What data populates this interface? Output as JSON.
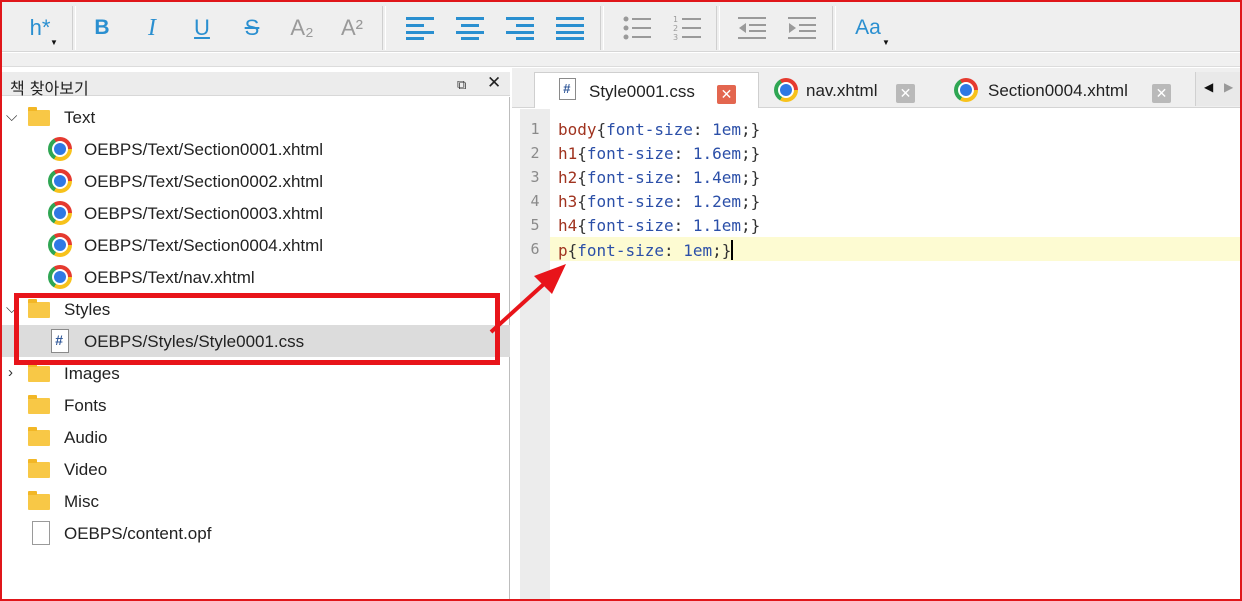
{
  "toolbar": {
    "heading_label": "h*",
    "bold_label": "B",
    "italic_label": "I",
    "underline_label": "U",
    "strike_label": "S",
    "subscript_label": "A₂",
    "superscript_label": "A²",
    "case_label": "Aa"
  },
  "book_browser": {
    "title": "책 찾아보기",
    "float_icon": "⧉",
    "close_icon": "✕",
    "folders": {
      "text": "Text",
      "styles": "Styles",
      "images": "Images",
      "fonts": "Fonts",
      "audio": "Audio",
      "video": "Video",
      "misc": "Misc"
    },
    "text_files": [
      "OEBPS/Text/Section0001.xhtml",
      "OEBPS/Text/Section0002.xhtml",
      "OEBPS/Text/Section0003.xhtml",
      "OEBPS/Text/Section0004.xhtml",
      "OEBPS/Text/nav.xhtml"
    ],
    "style_file": "OEBPS/Styles/Style0001.css",
    "opf_file": "OEBPS/content.opf"
  },
  "tabs": [
    {
      "label": "Style0001.css",
      "active": true
    },
    {
      "label": "nav.xhtml",
      "active": false
    },
    {
      "label": "Section0004.xhtml",
      "active": false
    }
  ],
  "editor": {
    "lines": [
      {
        "num": "1",
        "selector": "body",
        "property": "font-size",
        "value": "1em"
      },
      {
        "num": "2",
        "selector": "h1",
        "property": "font-size",
        "value": "1.6em"
      },
      {
        "num": "3",
        "selector": "h2",
        "property": "font-size",
        "value": "1.4em"
      },
      {
        "num": "4",
        "selector": "h3",
        "property": "font-size",
        "value": "1.2em"
      },
      {
        "num": "5",
        "selector": "h4",
        "property": "font-size",
        "value": "1.1em"
      },
      {
        "num": "6",
        "selector": "p",
        "property": "font-size",
        "value": "1em"
      }
    ]
  },
  "colors": {
    "annotation_red": "#e8141a",
    "accent_blue": "#2a8fd0",
    "current_line": "#fdfbd2"
  }
}
